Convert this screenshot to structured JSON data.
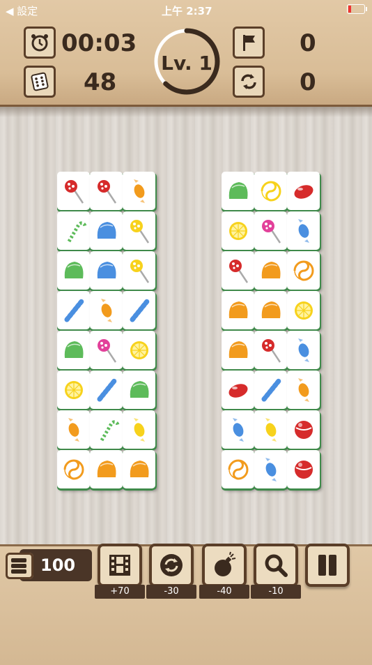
{
  "status_bar": {
    "back_label": "◀ 設定",
    "time": "上午 2:37"
  },
  "hud": {
    "timer": "00:03",
    "tiles_left": "48",
    "level": "Lv. 1",
    "hints_used": "0",
    "shuffles_used": "0",
    "level_progress": 0.62
  },
  "bottom": {
    "coins": "100",
    "costs": [
      "+70",
      "-30",
      "-40",
      "-10"
    ]
  },
  "boards": {
    "left": [
      [
        "lollipop-red",
        "lollipop-red",
        "wrapped-orange"
      ],
      [
        "candy-cane-green",
        "gumdrop-blue",
        "lollipop-yellow"
      ],
      [
        "gumdrop-green",
        "gumdrop-blue",
        "lollipop-yellow"
      ],
      [
        "stick-blue",
        "wrapped-orange",
        "stick-blue"
      ],
      [
        "gumdrop-green",
        "lollipop-pink",
        "lemon-slice"
      ],
      [
        "lemon-slice",
        "stick-blue",
        "gumdrop-green"
      ],
      [
        "wrapped-orange",
        "candy-cane-green",
        "wrapped-yellow"
      ],
      [
        "swirl-orange",
        "gumdrop-orange",
        "gumdrop-orange"
      ]
    ],
    "right": [
      [
        "gumdrop-green",
        "swirl-yellow",
        "jelly-red"
      ],
      [
        "lemon-slice",
        "lollipop-pink",
        "wrapped-blue"
      ],
      [
        "lollipop-red",
        "gumdrop-orange",
        "swirl-orange"
      ],
      [
        "gumdrop-orange",
        "gumdrop-orange",
        "lemon-slice"
      ],
      [
        "gumdrop-orange",
        "lollipop-red",
        "wrapped-blue"
      ],
      [
        "jelly-red",
        "stick-blue",
        "wrapped-orange"
      ],
      [
        "wrapped-blue",
        "wrapped-yellow",
        "ball-red"
      ],
      [
        "swirl-orange",
        "wrapped-blue",
        "ball-red"
      ]
    ]
  },
  "colors": {
    "wood_dark": "#5a3e28",
    "tile_edge": "#3f8a4a",
    "ring": "#3a2a1e"
  }
}
